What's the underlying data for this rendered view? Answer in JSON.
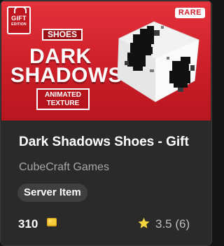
{
  "item": {
    "badge": {
      "line1": "GIFT",
      "line2": "EDITION"
    },
    "rarity": "RARE",
    "art": {
      "category_tag": "SHOES",
      "title_line1": "DARK",
      "title_line2": "SHADOWS",
      "sub_line1": "ANIMATED",
      "sub_line2": "TEXTURE"
    },
    "title": "Dark Shadows Shoes - Gift",
    "creator": "CubeCraft Games",
    "type_label": "Server Item",
    "price": "310",
    "rating": "3.5 (6)"
  },
  "colors": {
    "hero_red": "#d92630",
    "rarity_text": "#d11d28",
    "coin": "#f2c12e",
    "star": "#f4d23c"
  },
  "icons": {
    "coin": "minecoin-icon",
    "star": "star-icon",
    "gift": "gift-icon"
  }
}
